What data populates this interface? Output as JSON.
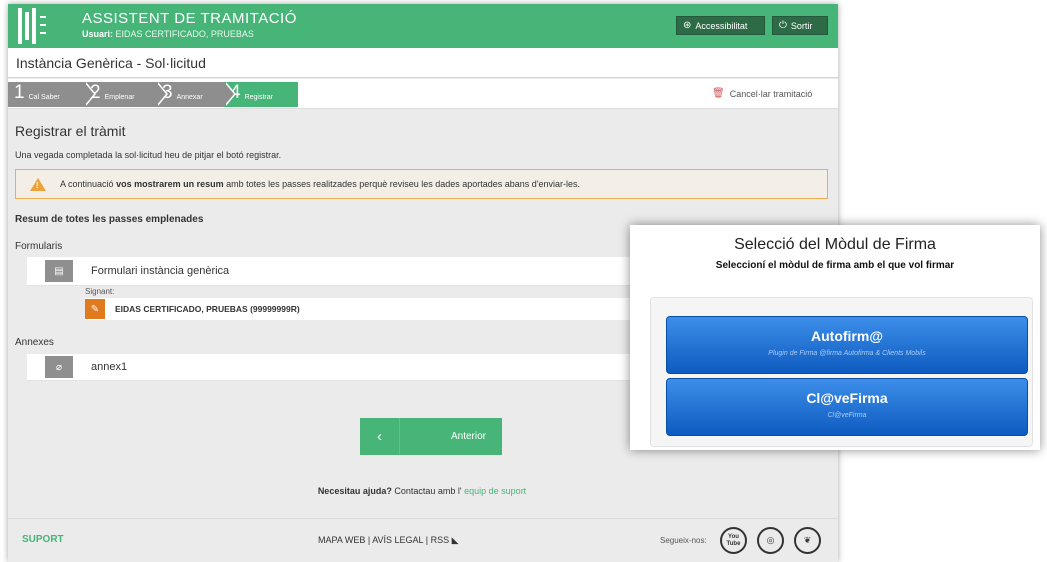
{
  "header": {
    "app_title": "ASSISTENT DE TRAMITACIÓ",
    "user_label": "Usuari:",
    "user_name": "EIDAS CERTIFICADO, PRUEBAS",
    "accessibility_label": "Accessibilitat",
    "logout_label": "Sortir",
    "accent_color": "#46b577"
  },
  "page_title": "Instància Genèrica - Sol·licitud",
  "steps": [
    {
      "num": "1",
      "label": "Cal Saber"
    },
    {
      "num": "2",
      "label": "Emplenar"
    },
    {
      "num": "3",
      "label": "Annexar"
    },
    {
      "num": "4",
      "label": "Registrar"
    }
  ],
  "cancel_label": "Cancel·lar tramitació",
  "section": {
    "title": "Registrar el tràmit",
    "description": "Una vegada completada la sol·licitud heu de pitjar el botó registrar."
  },
  "notice": {
    "pre": "A continuació",
    "bold": "vos mostrarem un resum",
    "post": "amb totes les passes realitzades perquè reviseu les dades aportades abans d'enviar-les."
  },
  "summary": {
    "title": "Resum de totes les passes emplenades",
    "forms_label": "Formularis",
    "form_name": "Formulari instància genèrica",
    "signer_label": "Signant:",
    "signer_name": "EIDAS CERTIFICADO, PRUEBAS (99999999R)",
    "annex_label": "Annexes",
    "annex_name": "annex1"
  },
  "prev_button": "Anterior",
  "help": {
    "bold": "Necesitau ajuda?",
    "text": "Contactau amb l'",
    "link": "equip de suport"
  },
  "footer": {
    "suport": "SUPORT",
    "mapa_web": "MAPA WEB",
    "avis_legal": "AVÍS LEGAL",
    "rss": "RSS",
    "follow": "Segueix-nos:",
    "youtube": "You Tube"
  },
  "dialog": {
    "title": "Selecció del Mòdul de Firma",
    "subtitle": "Seleccioní el mòdul de firma amb el que vol firmar",
    "options": [
      {
        "label": "Autofirm@",
        "sub": "Plugin de Firma @firma Autofirma & Clients Mobils"
      },
      {
        "label": "Cl@veFirma",
        "sub": "Cl@veFirma"
      }
    ],
    "button_color": "#1565c8"
  }
}
